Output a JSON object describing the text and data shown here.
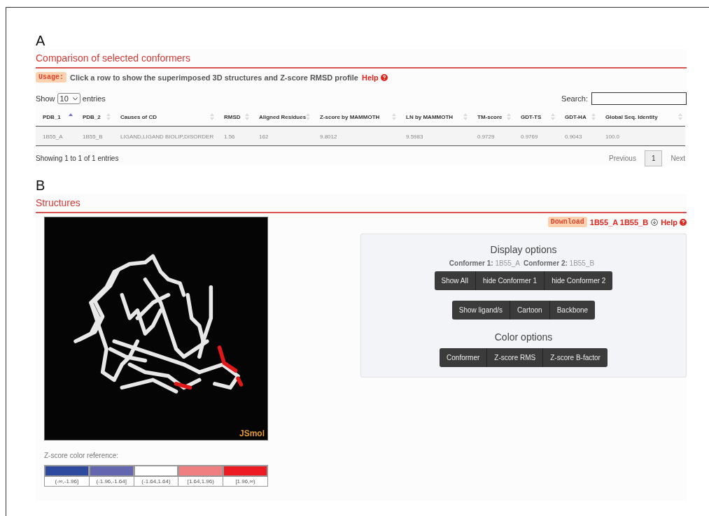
{
  "panel_a": {
    "letter": "A",
    "title": "Comparison of selected conformers",
    "usage": {
      "badge": "Usage:",
      "text": "Click a row to show the superimposed 3D structures and Z-score RMSD profile",
      "help": "Help"
    },
    "length": {
      "prefix": "Show",
      "value": "10",
      "suffix": "entries"
    },
    "search": {
      "label": "Search:"
    },
    "table": {
      "columns": [
        {
          "label": "PDB_1",
          "sorted": true
        },
        {
          "label": "PDB_2",
          "sorted": false
        },
        {
          "label": "Causes of CD",
          "sorted": false
        },
        {
          "label": "RMSD",
          "sorted": false
        },
        {
          "label": "Aligned Residues",
          "sorted": false
        },
        {
          "label": "Z-score by MAMMOTH",
          "sorted": false
        },
        {
          "label": "LN by MAMMOTH",
          "sorted": false
        },
        {
          "label": "TM-score",
          "sorted": false
        },
        {
          "label": "GDT-TS",
          "sorted": false
        },
        {
          "label": "GDT-HA",
          "sorted": false
        },
        {
          "label": "Global Seq. Identity",
          "sorted": false
        }
      ],
      "rows": [
        [
          "1B55_A",
          "1B55_B",
          "LIGAND,LIGAND BIOLIP,DISORDER",
          "1.56",
          "162",
          "9.8012",
          "9.5983",
          "0.9729",
          "0.9769",
          "0.9043",
          "100.0"
        ]
      ]
    },
    "info": "Showing 1 to 1 of 1 entries",
    "pagination": {
      "previous": "Previous",
      "pages": [
        {
          "label": "1",
          "selected": true
        }
      ],
      "next": "Next"
    }
  },
  "panel_b": {
    "letter": "B",
    "title": "Structures",
    "viewer": {
      "watermark": "JSmol"
    },
    "download": {
      "badge": "Download",
      "files": "1B55_A 1B55_B",
      "help": "Help"
    },
    "display_options": {
      "title": "Display options",
      "conformers": [
        {
          "label": "Conformer 1:",
          "value": "1B55_A"
        },
        {
          "label": "Conformer 2:",
          "value": "1B55_B"
        }
      ],
      "button_groups": [
        [
          "Show All",
          "hide Conformer 1",
          "hide Conformer 2"
        ],
        [
          "Show ligand/s",
          "Cartoon",
          "Backbone"
        ]
      ]
    },
    "color_options": {
      "title": "Color options",
      "buttons": [
        "Conformer",
        "Z-score RMS",
        "Z-score B-factor"
      ]
    },
    "color_reference": {
      "label": "Z-score color reference:",
      "items": [
        {
          "label": "(-∞,-1.96]",
          "color": "#2e4a9e"
        },
        {
          "label": "(-1.96,-1.64]",
          "color": "#6466b0"
        },
        {
          "label": "(-1.64,1.64)",
          "color": "#ffffff"
        },
        {
          "label": "[1.64,1.96)",
          "color": "#f07f82"
        },
        {
          "label": "[1.96,∞)",
          "color": "#ed1c24"
        }
      ]
    }
  }
}
